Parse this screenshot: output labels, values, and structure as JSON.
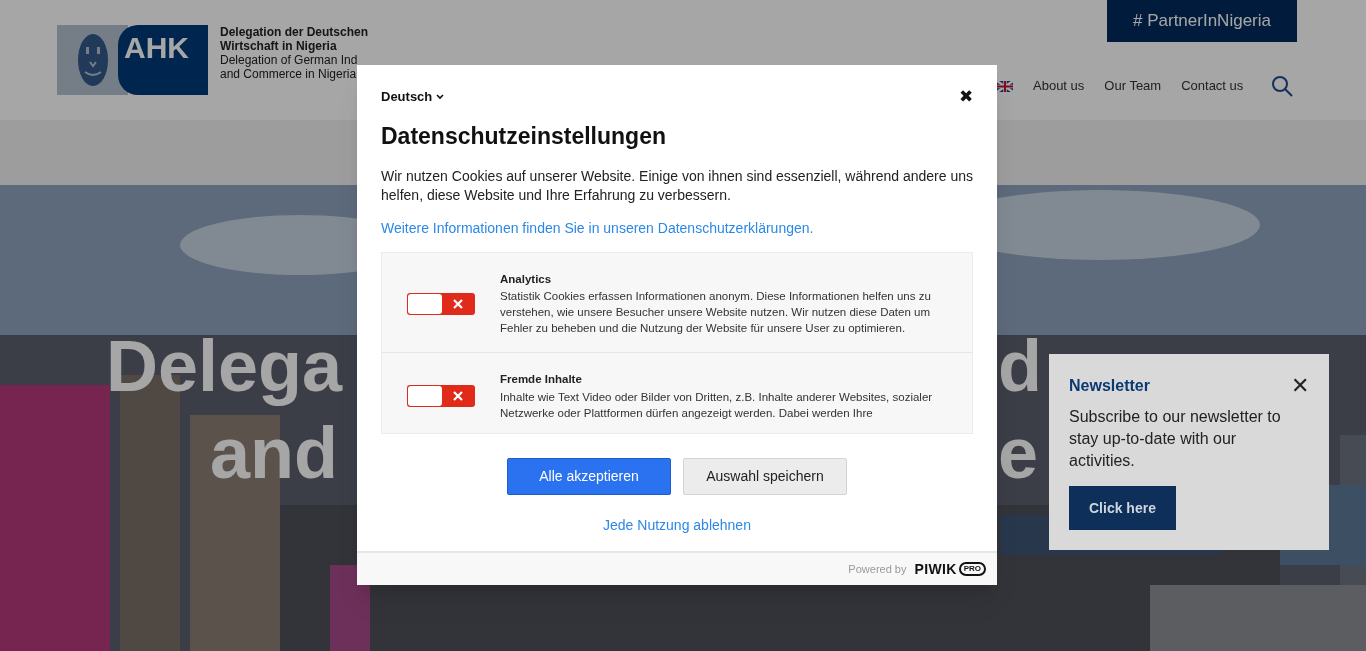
{
  "header": {
    "logo": {
      "mark": "AHK",
      "line_1": "Delegation der Deutschen",
      "line_2": "Wirtschaft in Nigeria",
      "line_3": "Delegation of German Ind",
      "line_4": "and Commerce in Nigeria"
    },
    "hashtag_button": "# PartnerInNigeria",
    "nav": [
      "About us",
      "Our Team",
      "Contact us"
    ]
  },
  "hero": {
    "line_1_left": "Delega",
    "line_1_right": "d",
    "line_2_left": "and",
    "line_2_right": "e"
  },
  "newsletter": {
    "title": "Newsletter",
    "close": "✕",
    "text": "Subscribe to our newsletter to stay up-to-date with our activities.",
    "button": "Click here"
  },
  "consent_dialog": {
    "language": "Deutsch",
    "close": "✖",
    "title": "Datenschutzeinstellungen",
    "intro": "Wir nutzen Cookies auf unserer Website. Einige von ihnen sind essenziell, während andere uns helfen, diese Website und Ihre Erfahrung zu verbessern.",
    "privacy_link": "Weitere Informationen finden Sie in unseren Datenschutzerklärungen.",
    "categories": [
      {
        "name": "Analytics",
        "description": "Statistik Cookies erfassen Informationen anonym. Diese Informationen helfen uns zu verstehen, wie unsere Besucher unsere Website nutzen. Wir nutzen diese Daten um Fehler zu beheben und die Nutzung der Website für unsere User zu optimieren.",
        "checked": false
      },
      {
        "name": "Fremde Inhalte",
        "description": "Inhalte wie Text Video oder Bilder von Dritten, z.B. Inhalte anderer Websites, sozialer Netzwerke oder Plattformen dürfen angezeigt werden. Dabei werden Ihre",
        "checked": false
      }
    ],
    "accept_button": "Alle akzeptieren",
    "save_button": "Auswahl speichern",
    "reject_link": "Jede Nutzung ablehnen",
    "powered_by": "Powered by",
    "brand": "PIWIK",
    "brand_badge": "PRO"
  }
}
